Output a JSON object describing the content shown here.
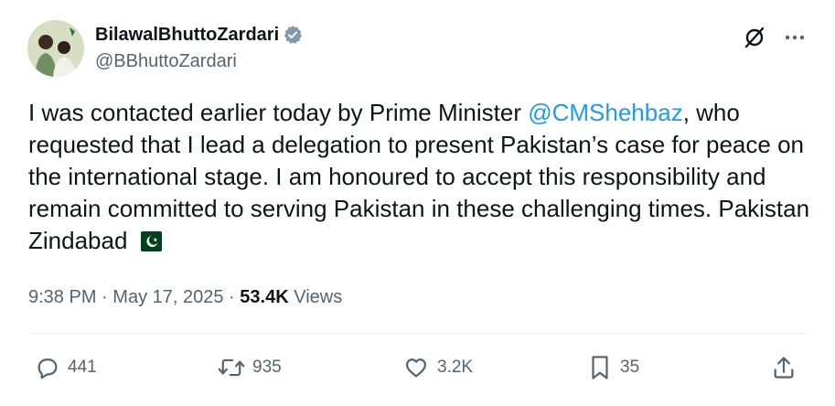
{
  "author": {
    "display_name": "BilawalBhuttoZardari",
    "handle": "@BBhuttoZardari",
    "verified_icon": "verified-badge-icon"
  },
  "tweet": {
    "text_before_mention": "I was contacted earlier today by Prime Minister ",
    "mention": "@CMShehbaz",
    "text_after_mention": ", who requested that I lead a delegation to present Pakistan’s case for peace on the international stage. I am honoured to accept this responsibility and remain committed to serving Pakistan in these challenging times. Pakistan Zindabad",
    "emoji_icon": "pakistan-flag-icon"
  },
  "meta": {
    "time": "9:38 PM",
    "separator": "·",
    "date": "May 17, 2025",
    "views_count": "53.4K",
    "views_label": "Views"
  },
  "actions": {
    "replies": "441",
    "reposts": "935",
    "likes": "3.2K",
    "bookmarks": "35"
  },
  "colors": {
    "text": "#0f1419",
    "secondary": "#536471",
    "accent": "#1d9bf0",
    "flag_green": "#01411c"
  }
}
